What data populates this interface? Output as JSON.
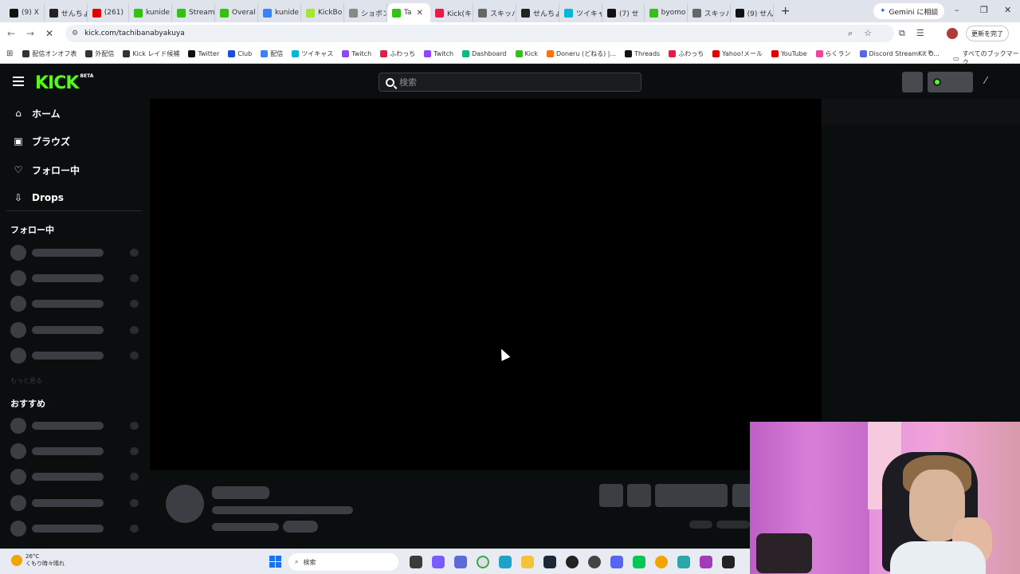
{
  "browser": {
    "tabs": [
      {
        "label": "(9) X",
        "favicon": "x-icon",
        "color": "#111111"
      },
      {
        "label": "せんちょ",
        "favicon": "circle-icon",
        "color": "#222222"
      },
      {
        "label": "(261) ",
        "favicon": "youtube-icon",
        "color": "#e00000"
      },
      {
        "label": "kunide",
        "favicon": "kick-icon",
        "color": "#33c214"
      },
      {
        "label": "Stream",
        "favicon": "kick-icon",
        "color": "#33c214"
      },
      {
        "label": "Overal",
        "favicon": "kick-icon",
        "color": "#33c214"
      },
      {
        "label": "kunide",
        "favicon": "circle-icon",
        "color": "#3b82f6"
      },
      {
        "label": "KickBo",
        "favicon": "leaf-icon",
        "color": "#a3e635"
      },
      {
        "label": "ショボン",
        "favicon": "chevron-icon",
        "color": "#888888"
      },
      {
        "label": "Ta",
        "favicon": "kick-icon",
        "color": "#33c214",
        "active": true
      },
      {
        "label": "Kick(キ",
        "favicon": "circle-icon",
        "color": "#e11d48"
      },
      {
        "label": "スキッパ",
        "favicon": "dots-icon",
        "color": "#666666"
      },
      {
        "label": "せんちょ",
        "favicon": "circle-icon",
        "color": "#222222"
      },
      {
        "label": "ツイキャ",
        "favicon": "circle-icon",
        "color": "#06b6d4"
      },
      {
        "label": "(7) せ",
        "favicon": "x-icon",
        "color": "#111111"
      },
      {
        "label": "byomo",
        "favicon": "kick-icon",
        "color": "#33c214"
      },
      {
        "label": "スキッパ",
        "favicon": "dots-icon",
        "color": "#666666"
      },
      {
        "label": "(9) せん",
        "favicon": "x-icon",
        "color": "#111111"
      }
    ],
    "new_tab": "+",
    "gemini_label": "Gemini に相談",
    "url": "kick.com/tachibanabyakuya",
    "update_label": "更新を完了",
    "bookmarks": [
      {
        "label": "配信オンオフ表",
        "color": "#333333"
      },
      {
        "label": "外配信",
        "color": "#333333"
      },
      {
        "label": "Kick レイド候補",
        "color": "#333333"
      },
      {
        "label": "Twitter",
        "color": "#111111"
      },
      {
        "label": "Club",
        "color": "#1d4ed8"
      },
      {
        "label": "配信",
        "color": "#3b82f6"
      },
      {
        "label": "ツイキャス",
        "color": "#06b6d4"
      },
      {
        "label": "Twitch",
        "color": "#9146ff"
      },
      {
        "label": "ふわっち",
        "color": "#e11d48"
      },
      {
        "label": "Twitch",
        "color": "#9146ff"
      },
      {
        "label": "Dashboard",
        "color": "#10b981"
      },
      {
        "label": "Kick",
        "color": "#33c214"
      },
      {
        "label": "Doneru (どねる) |...",
        "color": "#f97316"
      },
      {
        "label": "Threads",
        "color": "#111111"
      },
      {
        "label": "ふわっち",
        "color": "#e11d48"
      },
      {
        "label": "Yahoo!メール",
        "color": "#e00000"
      },
      {
        "label": "YouTube",
        "color": "#e00000"
      },
      {
        "label": "らくラン",
        "color": "#ec4899"
      },
      {
        "label": "Discord StreamKit O...",
        "color": "#5865f2"
      }
    ],
    "all_bookmarks": "すべてのブックマーク"
  },
  "kick": {
    "logo": "KICK",
    "logo_badge": "BETA",
    "search_placeholder": "検索",
    "nav": [
      {
        "label": "ホーム",
        "icon": "home-icon",
        "glyph": "⌂"
      },
      {
        "label": "ブラウズ",
        "icon": "browse-icon",
        "glyph": "▣"
      },
      {
        "label": "フォロー中",
        "icon": "heart-icon",
        "glyph": "♡"
      },
      {
        "label": "Drops",
        "icon": "drops-icon",
        "glyph": "⇩"
      }
    ],
    "following_header": "フォロー中",
    "show_more": "もっと見る",
    "recommended_header": "おすすめ"
  },
  "taskbar": {
    "temperature": "26°C",
    "weather": "くもり時々晴れ",
    "search_placeholder": "検索"
  }
}
